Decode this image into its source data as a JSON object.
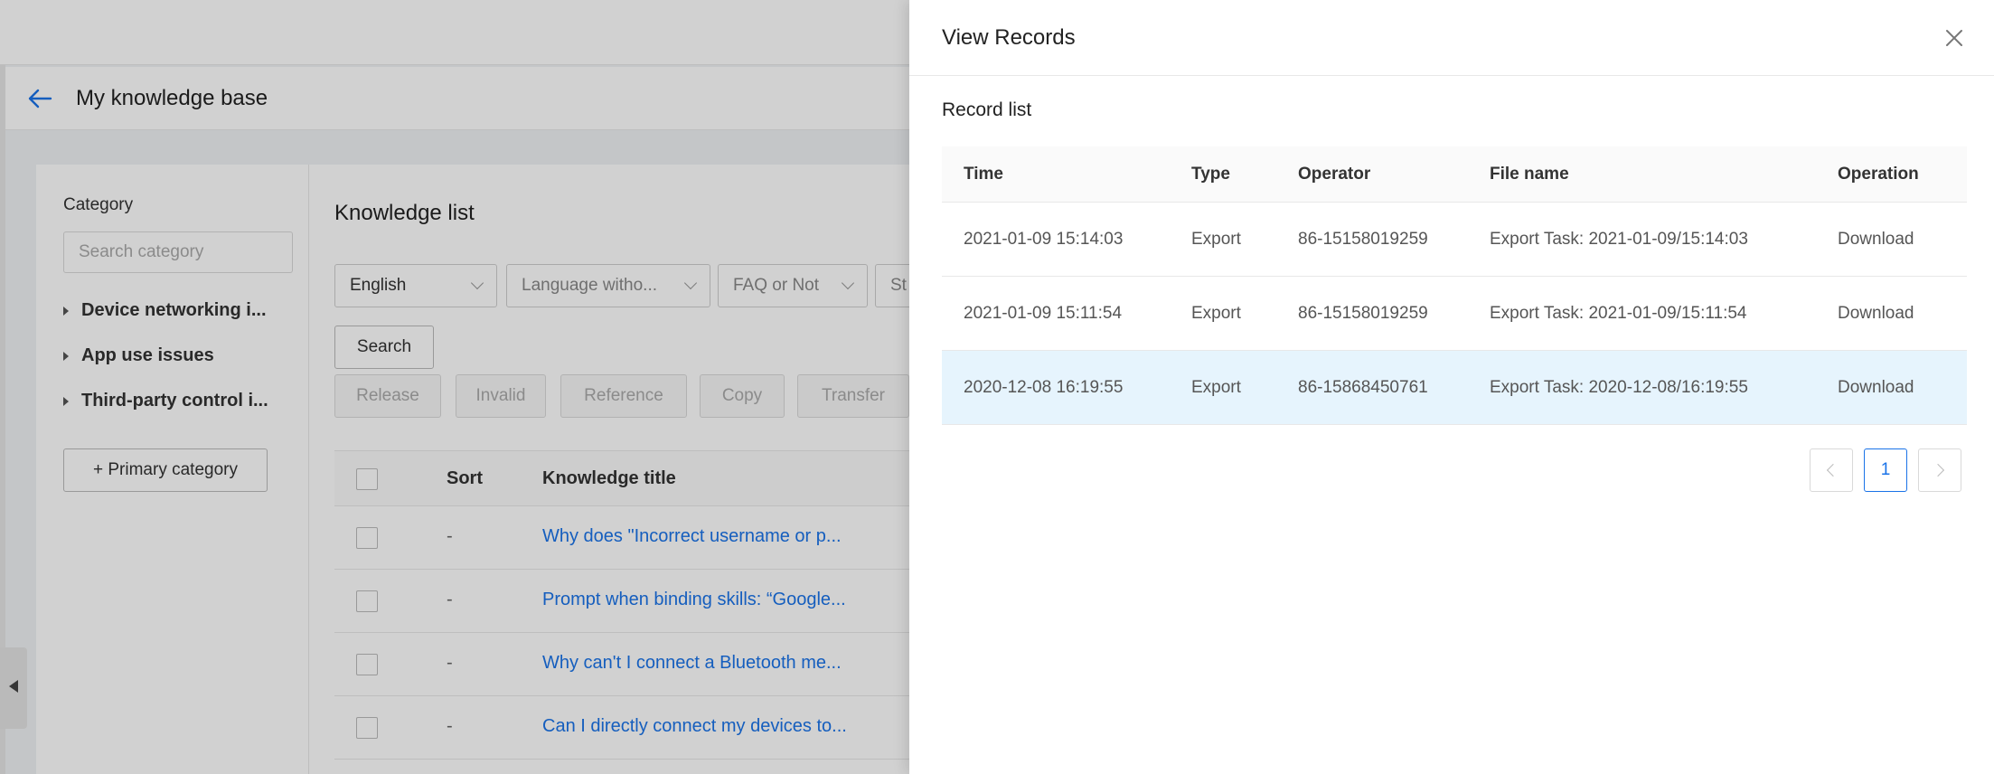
{
  "header": {
    "title": "My knowledge base"
  },
  "category": {
    "title": "Category",
    "search_placeholder": "Search category",
    "items": [
      {
        "label": "Device networking i..."
      },
      {
        "label": "App use issues"
      },
      {
        "label": "Third-party control i..."
      }
    ],
    "primary_button": "+ Primary category"
  },
  "knowledge_list": {
    "title": "Knowledge list",
    "filters": [
      {
        "value": "English"
      },
      {
        "value": "Language witho..."
      },
      {
        "value": "FAQ or Not"
      },
      {
        "value": "St"
      }
    ],
    "search_button": "Search",
    "actions": [
      "Release",
      "Invalid",
      "Reference",
      "Copy",
      "Transfer"
    ],
    "columns": {
      "sort": "Sort",
      "title": "Knowledge title"
    },
    "rows": [
      {
        "sort": "-",
        "title": "Why does \"Incorrect username or p..."
      },
      {
        "sort": "-",
        "title": "Prompt when binding skills: “Google..."
      },
      {
        "sort": "-",
        "title": "Why can't I connect a Bluetooth me..."
      },
      {
        "sort": "-",
        "title": "Can I directly connect my devices to..."
      }
    ]
  },
  "drawer": {
    "title": "View Records",
    "section_title": "Record list",
    "columns": {
      "time": "Time",
      "type": "Type",
      "operator": "Operator",
      "file_name": "File name",
      "operation": "Operation"
    },
    "rows": [
      {
        "time": "2021-01-09 15:14:03",
        "type": "Export",
        "operator": "86-15158019259",
        "file_name": "Export Task: 2021-01-09/15:14:03",
        "operation": "Download"
      },
      {
        "time": "2021-01-09 15:11:54",
        "type": "Export",
        "operator": "86-15158019259",
        "file_name": "Export Task: 2021-01-09/15:11:54",
        "operation": "Download"
      },
      {
        "time": "2020-12-08 16:19:55",
        "type": "Export",
        "operator": "86-15868450761",
        "file_name": "Export Task: 2020-12-08/16:19:55",
        "operation": "Download"
      }
    ],
    "pagination": {
      "current_page": "1"
    }
  },
  "icons": [
    "back-arrow-icon",
    "close-icon",
    "collapse-triangle-icon",
    "chevron-down-icon",
    "chevron-left-icon",
    "chevron-right-icon"
  ],
  "colors": {
    "accent": "#1a73e8",
    "highlight_row": "#e6f4fd"
  }
}
